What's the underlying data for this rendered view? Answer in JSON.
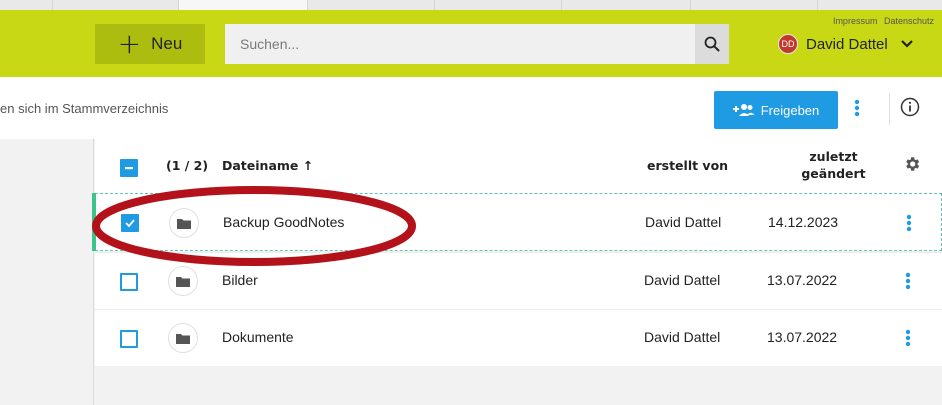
{
  "topbar": {
    "new_button_label": "Neu",
    "search_placeholder": "Suchen...",
    "legal_links": [
      "Impressum",
      "Datenschutz"
    ],
    "user": {
      "initials": "DD",
      "name": "David Dattel"
    }
  },
  "toolbar": {
    "breadcrumb": "en sich im Stammverzeichnis",
    "share_label": "Freigeben"
  },
  "table": {
    "selection_count": "(1 / 2)",
    "columns": {
      "name": "Dateiname ↑",
      "created_by": "erstellt von",
      "modified_line1": "zuletzt",
      "modified_line2": "geändert"
    },
    "rows": [
      {
        "name": "Backup GoodNotes",
        "created_by": "David Dattel",
        "modified": "14.12.2023",
        "checked": true
      },
      {
        "name": "Bilder",
        "created_by": "David Dattel",
        "modified": "13.07.2022",
        "checked": false
      },
      {
        "name": "Dokumente",
        "created_by": "David Dattel",
        "modified": "13.07.2022",
        "checked": false
      }
    ]
  },
  "colors": {
    "topbar": "#c8d815",
    "accent_blue": "#1e9be3",
    "annotation_red": "#b3121a",
    "selection_dash": "#5fc5b2"
  }
}
